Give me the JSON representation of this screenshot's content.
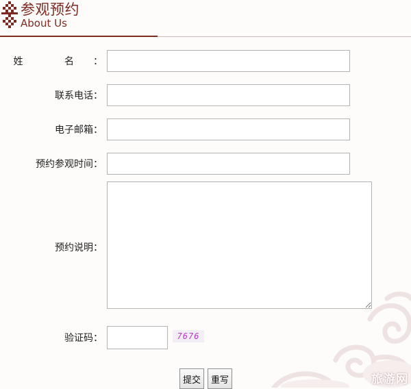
{
  "header": {
    "title_cn": "参观预约",
    "title_en": "About Us",
    "logo_icon": "ornamental-knot-icon",
    "accent_color": "#7c2a22"
  },
  "form": {
    "name_label": "姓 名",
    "phone_label": "联系电话：",
    "email_label": "电子邮箱：",
    "visit_time_label": "预约参观时间：",
    "description_label": "预约说明：",
    "captcha_label": "验证码：",
    "colon": "：",
    "name_value": "",
    "phone_value": "",
    "email_value": "",
    "visit_time_value": "",
    "description_value": "",
    "captcha_value": "",
    "captcha_code": "7676",
    "submit_label": "提交",
    "reset_label": "重写"
  },
  "watermark": "旅游网"
}
